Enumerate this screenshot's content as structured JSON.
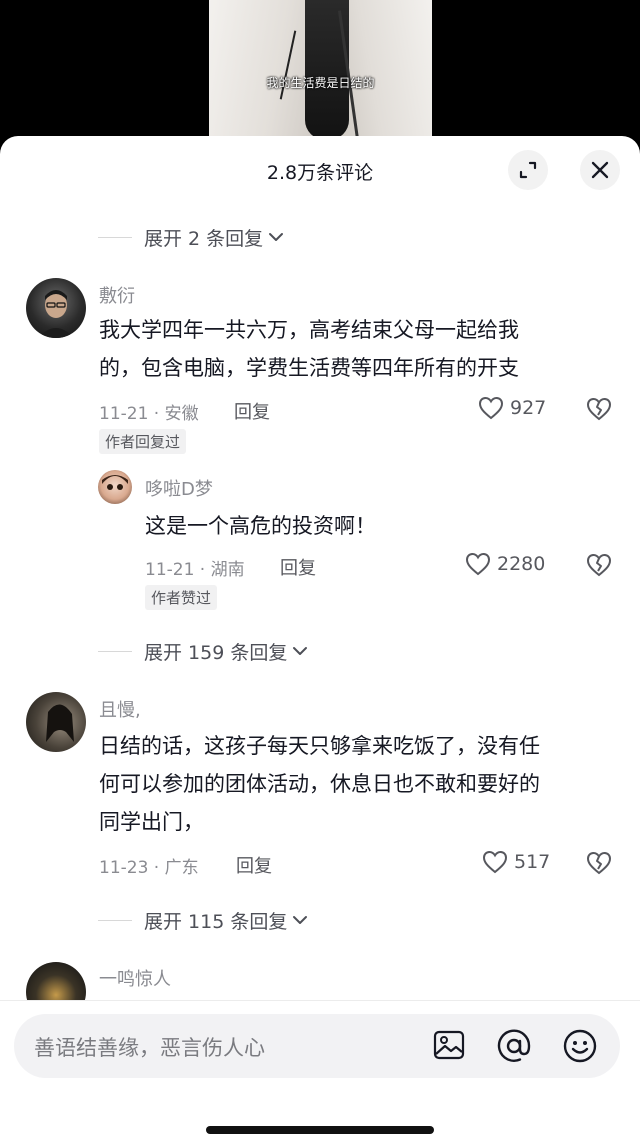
{
  "video": {
    "caption": "我的生活费是日结的"
  },
  "header": {
    "title": "2.8万条评论"
  },
  "expand_rows": [
    {
      "label": "展开 2 条回复"
    },
    {
      "label": "展开 159 条回复"
    },
    {
      "label": "展开 115 条回复"
    }
  ],
  "comments": [
    {
      "name": "敷衍",
      "text_lines": [
        "我大学四年一共六万，高考结束父母一起给我",
        "的，包含电脑，学费生活费等四年所有的开支"
      ],
      "meta": "11-21 · 安徽",
      "reply_label": "回复",
      "likes": "927",
      "tag": "作者回复过"
    },
    {
      "name": "哆啦D梦",
      "text_lines": [
        "这是一个高危的投资啊！"
      ],
      "meta": "11-21 · 湖南",
      "reply_label": "回复",
      "likes": "2280",
      "tag": "作者赞过"
    },
    {
      "name": "且慢,",
      "text_lines": [
        "日结的话，这孩子每天只够拿来吃饭了，没有任",
        "何可以参加的团体活动，休息日也不敢和要好的",
        "同学出门，"
      ],
      "meta": "11-23 · 广东",
      "reply_label": "回复",
      "likes": "517"
    },
    {
      "name": "一鸣惊人"
    }
  ],
  "input": {
    "placeholder": "善语结善缘，恶言伤人心"
  },
  "icons": [
    "expand-icon",
    "close-icon",
    "chevron-down-icon",
    "heart-icon",
    "broken-heart-icon",
    "image-icon",
    "at-icon",
    "emoji-icon"
  ]
}
